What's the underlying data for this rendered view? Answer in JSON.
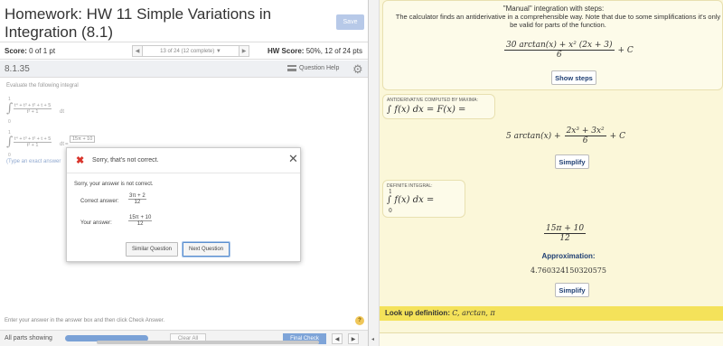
{
  "left": {
    "title": "Homework: HW 11 Simple Variations in Integration (8.1)",
    "save_label": "Save",
    "score_label": "Score:",
    "score_value": "0 of 1 pt",
    "pager_text": "13 of 24 (12 complete) ▼",
    "hw_score_label": "HW Score:",
    "hw_score_value": "50%, 12 of 24 pts",
    "question_number": "8.1.35",
    "question_help": "Question Help",
    "prompt": "Evaluate the following integral",
    "integral_numerator": "t⁴ + t³ + t² + t + 5",
    "integral_denominator": "t² + 1",
    "integral_dt": "dt",
    "upper_limit": "1",
    "lower_limit": "0",
    "entered_answer": "15π + 10",
    "type_exact": "(Type an exact answer",
    "enter_hint": "Enter your answer in the answer box and then click Check Answer.",
    "all_parts_label": "All parts showing",
    "clear_all_label": "Clear All",
    "final_check_label": "Final Check",
    "progress_fraction": 1.0
  },
  "dialog": {
    "header": "Sorry, that's not correct.",
    "body": "Sorry, your answer is not correct.",
    "correct_label": "Correct answer:",
    "correct_num": "3π + 2",
    "correct_den": "12",
    "your_label": "Your answer:",
    "your_num": "15π + 10",
    "your_den": "12",
    "similar_label": "Similar Question",
    "next_label": "Next Question"
  },
  "right": {
    "steps_title": "\"Manual\" integration with steps:",
    "steps_desc": "The calculator finds an antiderivative in a comprehensible way. Note that due to some simplifications it's only be valid for parts of the function.",
    "result1_num": "30 arctan(x) + x² (2x + 3)",
    "result1_den": "6",
    "plus_c": "+ C",
    "show_steps_label": "Show steps",
    "anti_label": "ANTIDERIVATIVE COMPUTED BY MAXIMA:",
    "anti_expr": "∫ f(x) dx = F(x) =",
    "result2_lead": "5 arctan(x) +",
    "result2_num": "2x³ + 3x²",
    "result2_den": "6",
    "simplify_label": "Simplify",
    "def_label": "DEFINITE INTEGRAL:",
    "def_upper": "1",
    "def_lower": "0",
    "def_expr": "∫ f(x) dx =",
    "result3_num": "15π + 10",
    "result3_den": "12",
    "approx_label": "Approximation:",
    "approx_value": "4.760324150320575",
    "lookup_label": "Look up definition:",
    "lookup_terms": "C, arctan, π"
  },
  "colors": {
    "save_button": "#b7c9e8",
    "error_x": "#d9342b",
    "panel_yellow": "#fbf7d9",
    "lookup_yellow": "#f4e25a",
    "button_text": "#1f3f73",
    "final_check": "#7ea4d8"
  }
}
